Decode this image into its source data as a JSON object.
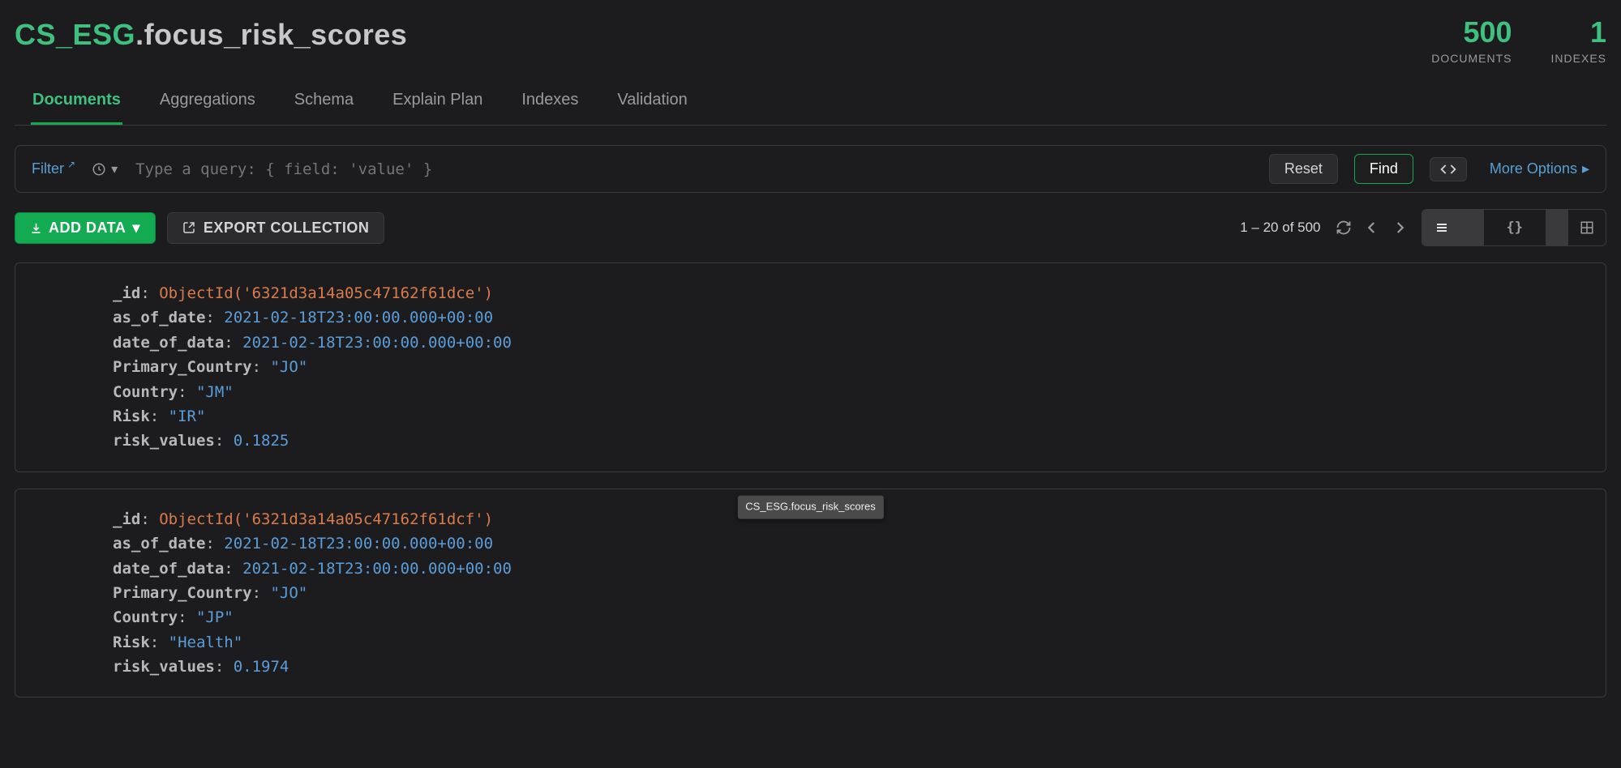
{
  "header": {
    "database": "CS_ESG",
    "collection": ".focus_risk_scores",
    "stats": [
      {
        "value": "500",
        "label": "DOCUMENTS"
      },
      {
        "value": "1",
        "label": "INDEXES"
      }
    ]
  },
  "tabs": [
    "Documents",
    "Aggregations",
    "Schema",
    "Explain Plan",
    "Indexes",
    "Validation"
  ],
  "active_tab": 0,
  "filter": {
    "label": "Filter",
    "placeholder": "Type a query: { field: 'value' }",
    "reset": "Reset",
    "find": "Find",
    "more": "More Options"
  },
  "actions": {
    "add": "ADD DATA",
    "export": "EXPORT COLLECTION",
    "range": "1 – 20 of 500"
  },
  "tooltip": "CS_ESG.focus_risk_scores",
  "documents": [
    {
      "_id": "ObjectId('6321d3a14a05c47162f61dce')",
      "as_of_date": "2021-02-18T23:00:00.000+00:00",
      "date_of_data": "2021-02-18T23:00:00.000+00:00",
      "Primary_Country": "\"JO\"",
      "Country": "\"JM\"",
      "Risk": "\"IR\"",
      "risk_values": "0.1825"
    },
    {
      "_id": "ObjectId('6321d3a14a05c47162f61dcf')",
      "as_of_date": "2021-02-18T23:00:00.000+00:00",
      "date_of_data": "2021-02-18T23:00:00.000+00:00",
      "Primary_Country": "\"JO\"",
      "Country": "\"JP\"",
      "Risk": "\"Health\"",
      "risk_values": "0.1974"
    }
  ]
}
